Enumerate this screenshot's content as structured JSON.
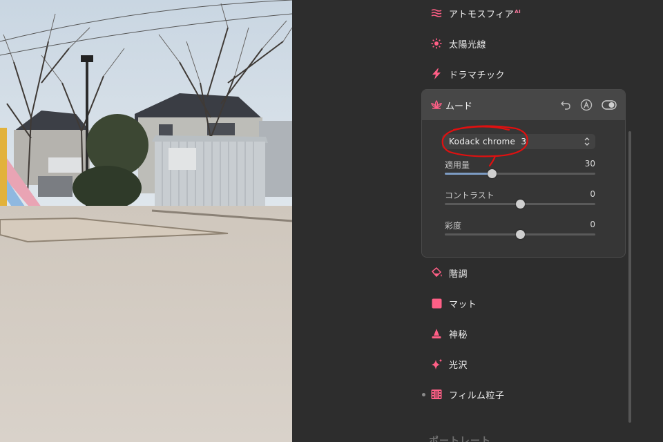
{
  "colors": {
    "accent": "#ff5f86",
    "panel_bg": "#2d2d2d",
    "card_bg": "#363636",
    "annotation": "#e01010"
  },
  "tools": [
    {
      "label": "アトモスフィア",
      "badge": "AI",
      "icon": "wave-icon"
    },
    {
      "label": "太陽光線",
      "icon": "sun-icon"
    },
    {
      "label": "ドラマチック",
      "icon": "lightning-icon"
    }
  ],
  "mood": {
    "title": "ムード",
    "icon": "lotus-icon",
    "header_buttons": [
      "undo-icon",
      "auto-icon",
      "toggle-icon"
    ],
    "preset": "Kodack chrome  3",
    "sliders": [
      {
        "label": "適用量",
        "value": "30",
        "level": 0.31
      },
      {
        "label": "コントラスト",
        "value": "0",
        "level": 0.5
      },
      {
        "label": "彩度",
        "value": "0",
        "level": 0.5
      }
    ]
  },
  "tools_after": [
    {
      "label": "階調",
      "icon": "paint-bucket-icon"
    },
    {
      "label": "マット",
      "icon": "square-icon"
    },
    {
      "label": "神秘",
      "icon": "cone-icon"
    },
    {
      "label": "光沢",
      "icon": "sparkle-icon"
    },
    {
      "label": "フィルム粒子",
      "icon": "film-icon"
    }
  ],
  "next_section": "ポートレート"
}
